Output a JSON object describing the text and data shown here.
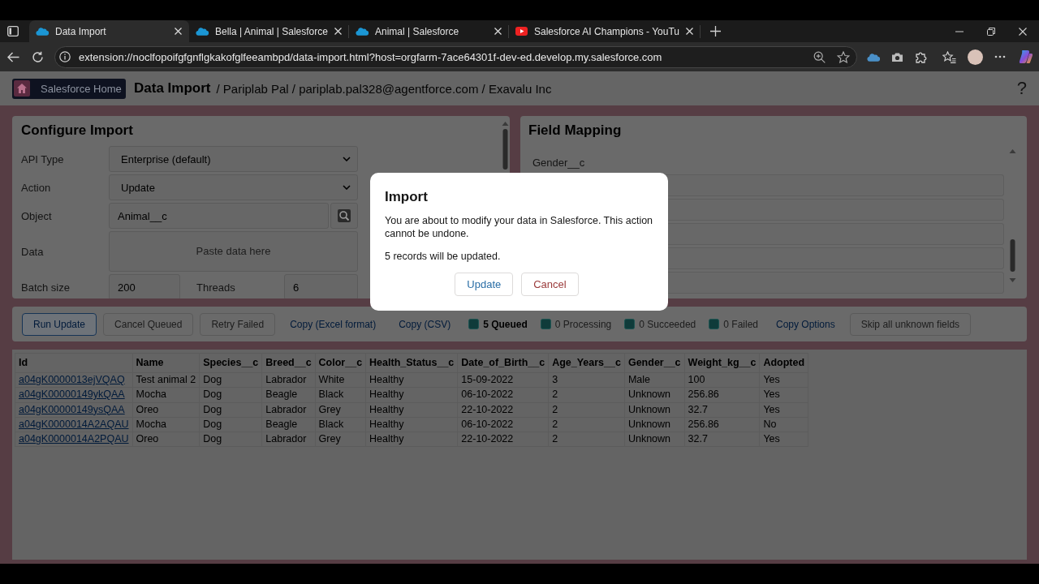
{
  "browser": {
    "tabs": [
      {
        "title": "Data Import",
        "selected": true
      },
      {
        "title": "Bella | Animal | Salesforce",
        "selected": false
      },
      {
        "title": "Animal | Salesforce",
        "selected": false
      },
      {
        "title": "Salesforce AI Champions - YouTu",
        "selected": false
      }
    ],
    "address": "extension://noclfopoifgfgnflgkakofglfeeambpd/data-import.html?host=orgfarm-7ace64301f-dev-ed.develop.my.salesforce.com"
  },
  "header": {
    "home_button": "Salesforce Home",
    "title": "Data Import",
    "context": "/ Pariplab Pal / pariplab.pal328@agentforce.com / Exavalu Inc",
    "help_button": "?"
  },
  "configure_import": {
    "title": "Configure Import",
    "fields": [
      {
        "kind": "select",
        "label": "API Type",
        "value": "Enterprise (default)"
      },
      {
        "kind": "select",
        "label": "Action",
        "value": "Update"
      },
      {
        "kind": "lookup",
        "label": "Object",
        "value": "Animal__c"
      },
      {
        "kind": "textarea",
        "label": "Data",
        "placeholder": "Paste data here"
      }
    ],
    "batch_size": {
      "label": "Batch size",
      "value": "200"
    },
    "threads": {
      "label": "Threads",
      "value": "6"
    }
  },
  "field_mapping": {
    "title": "Field Mapping",
    "rows": [
      {
        "field": "Gender__c"
      }
    ]
  },
  "toolbar": {
    "items": [
      {
        "kind": "button",
        "label": "Run Update",
        "disabled": false
      },
      {
        "kind": "button",
        "label": "Cancel Queued",
        "disabled": true
      },
      {
        "kind": "button",
        "label": "Retry Failed",
        "disabled": true
      },
      {
        "kind": "link",
        "label": "Copy (Excel format)",
        "disabled": false
      },
      {
        "kind": "link",
        "label": "Copy (CSV)",
        "disabled": false
      },
      {
        "kind": "checkbox",
        "label": "5 Queued",
        "checked": true,
        "disabled": false
      },
      {
        "kind": "checkbox",
        "label": "0 Processing",
        "checked": true,
        "disabled": true
      },
      {
        "kind": "checkbox",
        "label": "0 Succeeded",
        "checked": true,
        "disabled": true
      },
      {
        "kind": "checkbox",
        "label": "0 Failed",
        "checked": true,
        "disabled": true
      },
      {
        "kind": "link",
        "label": "Copy Options",
        "disabled": false
      },
      {
        "kind": "button",
        "label": "Skip all unknown fields",
        "disabled": true
      }
    ]
  },
  "table": {
    "columns": [
      "Id",
      "Name",
      "Species__c",
      "Breed__c",
      "Color__c",
      "Health_Status__c",
      "Date_of_Birth__c",
      "Age_Years__c",
      "Gender__c",
      "Weight_kg__c",
      "Adopted"
    ],
    "rows": [
      [
        "a04gK0000013ejVQAQ",
        "Test animal 2",
        "Dog",
        "Labrador",
        "White",
        "Healthy",
        "15-09-2022",
        "3",
        "Male",
        "100",
        "Yes"
      ],
      [
        "a04gK00000149ykQAA",
        "Mocha",
        "Dog",
        "Beagle",
        "Black",
        "Healthy",
        "06-10-2022",
        "2",
        "Unknown",
        "256.86",
        "Yes"
      ],
      [
        "a04gK00000149ysQAA",
        "Oreo",
        "Dog",
        "Labrador",
        "Grey",
        "Healthy",
        "22-10-2022",
        "2",
        "Unknown",
        "32.7",
        "Yes"
      ],
      [
        "a04gK0000014A2AQAU",
        "Mocha",
        "Dog",
        "Beagle",
        "Black",
        "Healthy",
        "06-10-2022",
        "2",
        "Unknown",
        "256.86",
        "No"
      ],
      [
        "a04gK0000014A2PQAU",
        "Oreo",
        "Dog",
        "Labrador",
        "Grey",
        "Healthy",
        "22-10-2022",
        "2",
        "Unknown",
        "32.7",
        "Yes"
      ]
    ]
  },
  "dialog": {
    "title": "Import",
    "message": "You are about to modify your data in Salesforce. This action cannot be undone.",
    "detail": "5 records will be updated.",
    "buttons": [
      {
        "kind": "confirm",
        "label": "Update"
      },
      {
        "kind": "cancel",
        "label": "Cancel"
      }
    ]
  }
}
